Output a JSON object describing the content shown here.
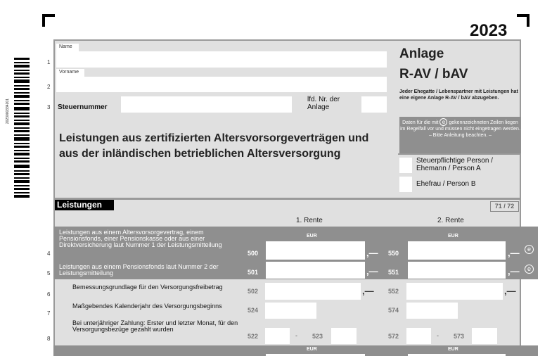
{
  "header": {
    "year": "2023"
  },
  "barcode": {
    "number": "2023000334201"
  },
  "personal": {
    "name_label": "Name",
    "vorname_label": "Vorname",
    "steuernummer_label": "Steuernummer",
    "lfd_nr_label": "lfd. Nr. der Anlage",
    "line_numbers": [
      "1",
      "2",
      "3"
    ]
  },
  "form_title": "Leistungen aus zertifizierten Altersvorsorgeverträgen und aus der inländischen betrieblichen Altersversorgung",
  "anlage": {
    "title": "Anlage",
    "subtitle": "R-AV / bAV",
    "instructions": "Jeder Ehegatte / Lebenspartner mit Leistungen hat eine eigene Anlage R-AV / bAV abzugeben.",
    "info_pre": "Daten für die mit",
    "info_symbol": "e",
    "info_post": "gekennzeichneten Zeilen liegen im Regelfall vor und müssen nicht eingetragen werden. – Bitte Anleitung beachten. –",
    "person_a": "Steuerpflichtige Person / Ehemann / Person A",
    "person_b": "Ehefrau / Person B"
  },
  "section": {
    "title": "Leistungen",
    "page_codes": "71 / 72",
    "rente1_label": "1. Rente",
    "rente2_label": "2. Rente",
    "currency": "EUR",
    "rows": [
      {
        "line": "4",
        "text": "Leistungen aus einem Altersvorsorgevertrag, einem Pensionsfonds, einer Pensionskasse oder aus einer Direktversicherung laut Nummer 1 der Leistungsmitteilung",
        "code1": "500",
        "code2": "550",
        "suffix": ",—",
        "marker": "e"
      },
      {
        "line": "5",
        "text": "Leistungen aus einem Pensionsfonds laut Nummer 2 der Leistungsmitteilung",
        "code1": "501",
        "code2": "551",
        "suffix": ",—",
        "marker": "e"
      },
      {
        "line": "6",
        "text": "Bemessungsgrundlage für den Versorgungsfreibetrag",
        "code1": "502",
        "code2": "552",
        "suffix": ",—"
      },
      {
        "line": "7",
        "text": "Maßgebendes Kalenderjahr des Versorgungsbeginns",
        "code1": "524",
        "code2": "574"
      },
      {
        "line": "8",
        "text": "Bei unterjähriger Zahlung: Erster und letzter Monat, für den Versorgungsbezüge gezahlt wurden",
        "code1": "522",
        "code1b": "523",
        "code2": "572",
        "code2b": "573",
        "separator": "-"
      }
    ]
  }
}
